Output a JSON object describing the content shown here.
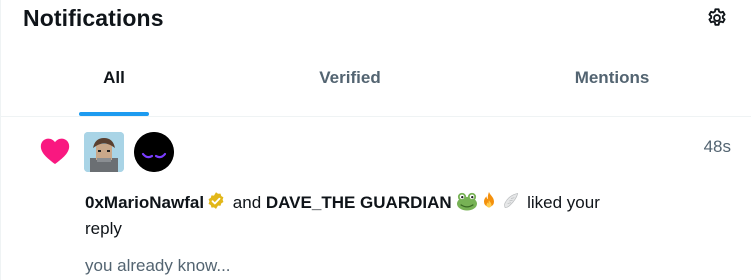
{
  "header": {
    "title": "Notifications"
  },
  "tabs": [
    {
      "label": "All",
      "active": true
    },
    {
      "label": "Verified",
      "active": false
    },
    {
      "label": "Mentions",
      "active": false
    }
  ],
  "notification": {
    "time": "48s",
    "actor1": "0xMarioNawfal",
    "conjunction": "and",
    "actor2": "DAVE_THE GUARDIAN",
    "action_line1": "liked your",
    "action_line2": "reply",
    "preview": "you already know..."
  },
  "colors": {
    "accent": "#1d9bf0",
    "like": "#f91880",
    "verified_gold": "#e2b719",
    "secondary_text": "#536471"
  }
}
